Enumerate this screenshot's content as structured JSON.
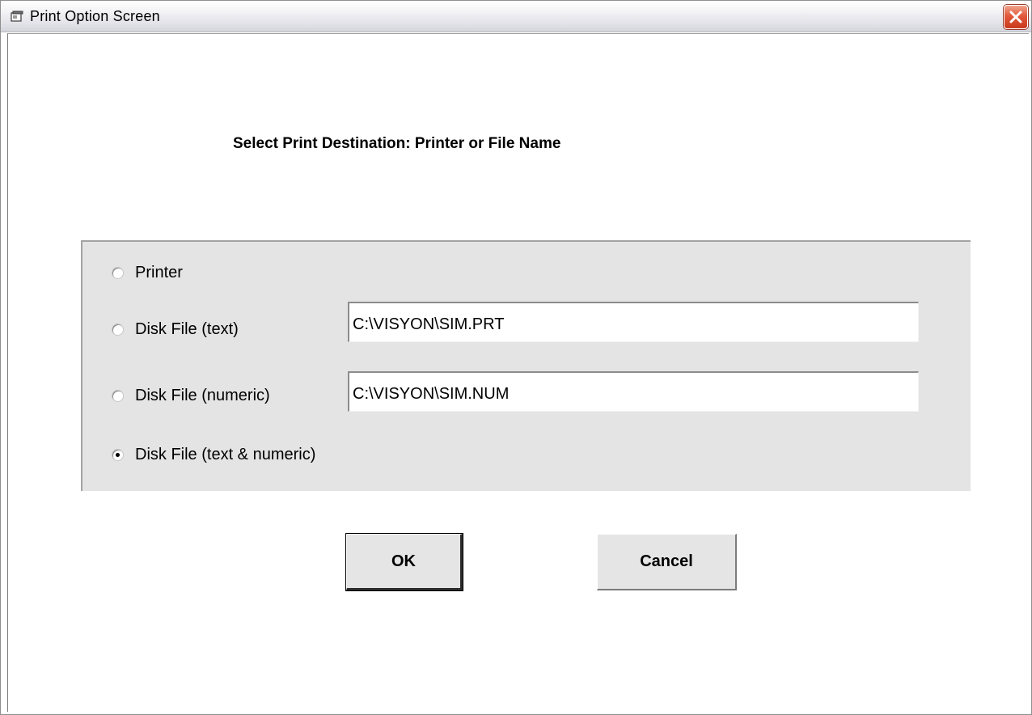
{
  "window": {
    "title": "Print Option Screen",
    "close_icon": "close-icon",
    "app_icon": "window-icon"
  },
  "heading": "Select Print Destination: Printer or File Name",
  "options": [
    {
      "label": "Printer",
      "checked": false
    },
    {
      "label": "Disk File (text)",
      "checked": false,
      "path": "C:\\VISYON\\SIM.PRT"
    },
    {
      "label": "Disk File (numeric)",
      "checked": false,
      "path": "C:\\VISYON\\SIM.NUM"
    },
    {
      "label": "Disk File (text & numeric)",
      "checked": true
    }
  ],
  "buttons": {
    "ok": "OK",
    "cancel": "Cancel"
  },
  "colors": {
    "close_button": "#d9472b",
    "frame_background": "#e4e4e4",
    "button_face": "#e5e5e5"
  }
}
